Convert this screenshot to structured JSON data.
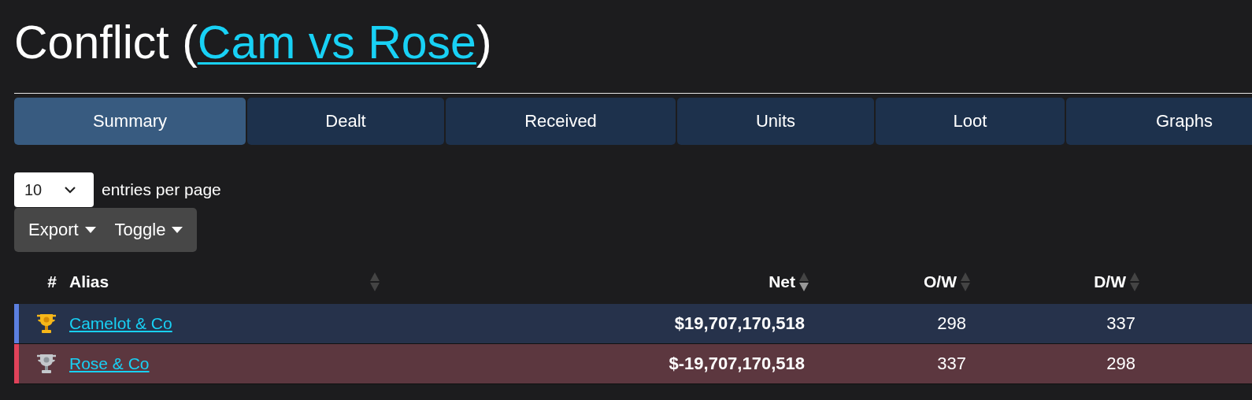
{
  "title": {
    "prefix": "Conflict (",
    "link": "Cam vs Rose",
    "suffix": ")"
  },
  "tabs": [
    {
      "label": "Summary",
      "selected": true
    },
    {
      "label": "Dealt",
      "selected": false
    },
    {
      "label": "Received",
      "selected": false
    },
    {
      "label": "Units",
      "selected": false
    },
    {
      "label": "Loot",
      "selected": false
    },
    {
      "label": "Graphs",
      "selected": false
    }
  ],
  "page_size": {
    "value": "10",
    "label": "entries per page"
  },
  "buttons": [
    {
      "label": "Export"
    },
    {
      "label": "Toggle"
    }
  ],
  "table": {
    "columns": [
      {
        "label": "#"
      },
      {
        "label": "Alias",
        "sorted_desc": false
      },
      {
        "label": "Net",
        "sorted_desc": true
      },
      {
        "label": "O/W",
        "sorted_desc": false
      },
      {
        "label": "D/W",
        "sorted_desc": false
      }
    ],
    "rows": [
      {
        "kind": "gold",
        "color": "#5b7fe0",
        "alias": "Camelot & Co",
        "net": "$19,707,170,518",
        "ow": "298",
        "dw": "337"
      },
      {
        "kind": "silver",
        "color": "#e0425a",
        "alias": "Rose & Co",
        "net": "$-19,707,170,518",
        "ow": "337",
        "dw": "298"
      }
    ]
  }
}
